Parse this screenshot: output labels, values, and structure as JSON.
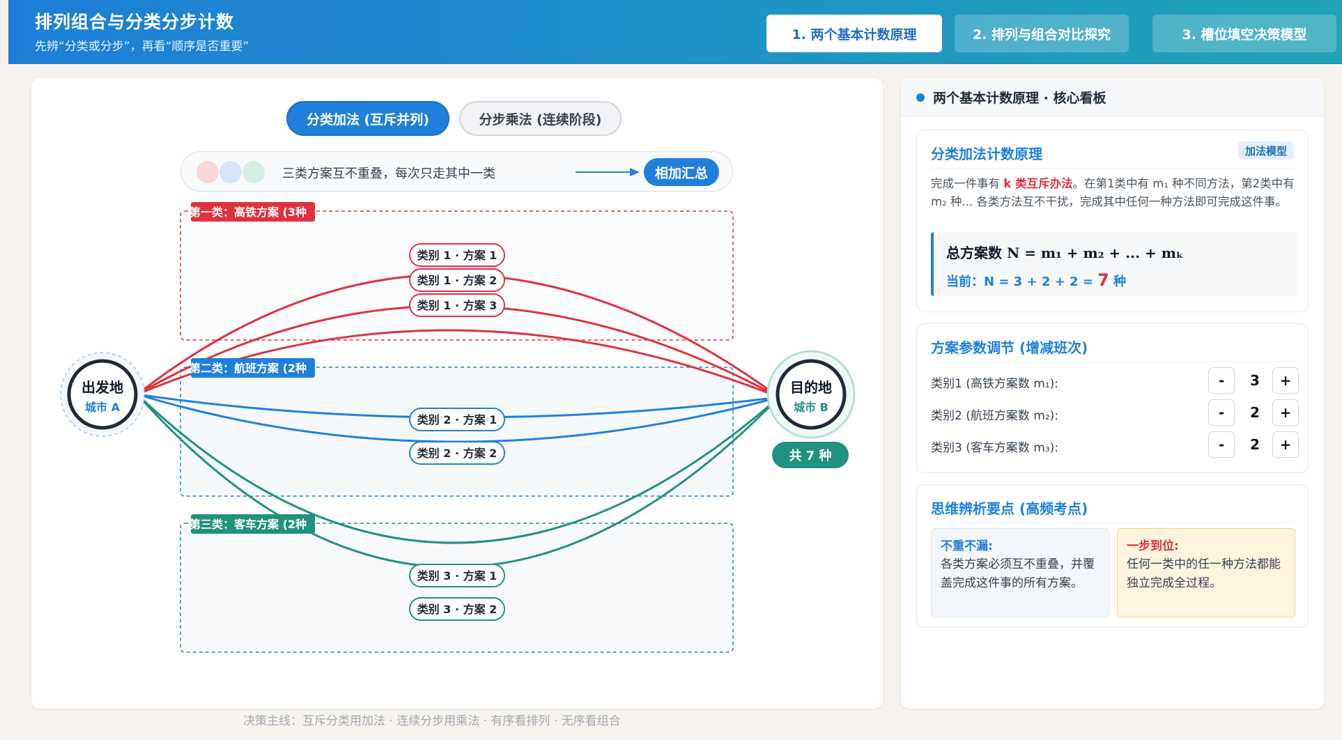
{
  "header": {
    "title": "排列组合与分类分步计数",
    "subtitle": "先辨“分类或分步”，再看“顺序是否重要”",
    "tabs": [
      {
        "label": "1. 两个基本计数原理",
        "active": true
      },
      {
        "label": "2. 排列与组合对比探究",
        "active": false
      },
      {
        "label": "3. 槽位填空决策模型",
        "active": false
      }
    ]
  },
  "mode_toggle": {
    "addition_label": "分类加法 (互斥并列)",
    "multiplication_label": "分步乘法 (连续阶段)"
  },
  "info_bar": {
    "text": "三类方案互不重叠，每次只走其中一类",
    "button_label": "相加汇总",
    "dot_colors": [
      "#f9d7db",
      "#d5e6fa",
      "#d6ede6"
    ]
  },
  "diagram": {
    "origin": {
      "label": "出发地",
      "city": "城市 A"
    },
    "destination": {
      "label": "目的地",
      "city": "城市 B"
    },
    "total_label": "共 7 种",
    "colors": {
      "rail": "#e0313f",
      "flight": "#1f80dc",
      "bus": "#219180"
    },
    "groups": [
      {
        "tag": "第一类：高铁方案 (3种",
        "color": "#e0313f",
        "options": [
          "类别 1 · 方案 1",
          "类别 1 · 方案 2",
          "类别 1 · 方案 3"
        ]
      },
      {
        "tag": "第二类：航班方案 (2种",
        "color": "#1f80dc",
        "options": [
          "类别 2 · 方案 1",
          "类别 2 · 方案 2"
        ]
      },
      {
        "tag": "第三类：客车方案 (2种",
        "color": "#219180",
        "options": [
          "类别 3 · 方案 1",
          "类别 3 · 方案 2"
        ]
      }
    ]
  },
  "footer_note": "决策主线：互斥分类用加法 · 连续分步用乘法 · 有序看排列 · 无序看组合",
  "right_panel": {
    "title": "两个基本计数原理 · 核心看板",
    "principle_card": {
      "title": "分类加法计数原理",
      "chip": "加法模型",
      "desc_prefix": "完成一件事有 ",
      "desc_highlight": "k 类互斥办法",
      "desc_suffix": "。在第1类中有 m₁ 种不同方法，第2类中有 m₂ 种... 各类方法互不干扰，完成其中任何一种方法即可完成这件事。",
      "formula": "总方案数 N = m₁ + m₂ + ... + mₖ",
      "current_prefix": "当前：N = 3 + 2 + 2 = ",
      "current_total": "7",
      "current_suffix": " 种"
    },
    "params_card": {
      "title": "方案参数调节 (增减班次)",
      "minus": "-",
      "plus": "+",
      "params": [
        {
          "label": "类别1 (高铁方案数 m₁):",
          "value": "3"
        },
        {
          "label": "类别2 (航班方案数 m₂):",
          "value": "2"
        },
        {
          "label": "类别3 (客车方案数 m₃):",
          "value": "2"
        }
      ]
    },
    "tips_card": {
      "title": "思维辨析要点 (高频考点)",
      "tips": [
        {
          "title": "不重不漏:",
          "body": "各类方案必须互不重叠，并覆盖完成这件事的所有方案。"
        },
        {
          "title": "一步到位:",
          "body": "任何一类中的任一种方法都能独立完成全过程。"
        }
      ]
    }
  }
}
